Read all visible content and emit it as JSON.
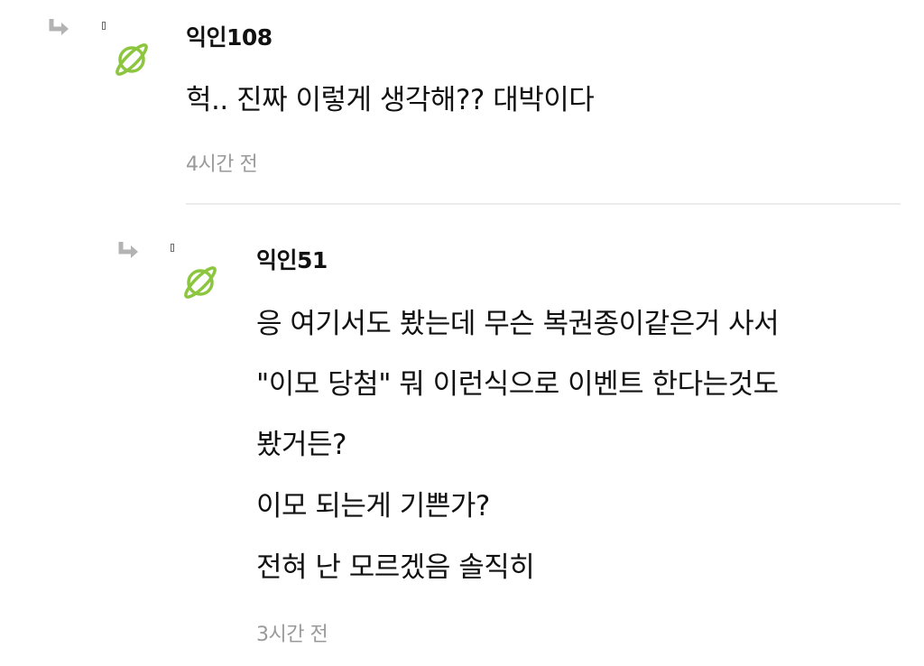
{
  "icons": {
    "reply": "reply-arrow-icon",
    "avatar": "planet-icon",
    "avatar_color": "#8cc63f",
    "reply_color": "#b3b3b3"
  },
  "comments": [
    {
      "author": "익인108",
      "lines": [
        "헉.. 진짜 이렇게 생각해?? 대박이다"
      ],
      "time": "4시간 전"
    },
    {
      "author": "익인51",
      "lines": [
        "응 여기서도 봤는데 무슨 복권종이같은거 사서",
        "\"이모 당첨\" 뭐 이런식으로 이벤트 한다는것도",
        "봤거든?",
        "이모 되는게 기쁜가?",
        "전혀 난 모르겠음 솔직히"
      ],
      "time": "3시간 전"
    }
  ]
}
